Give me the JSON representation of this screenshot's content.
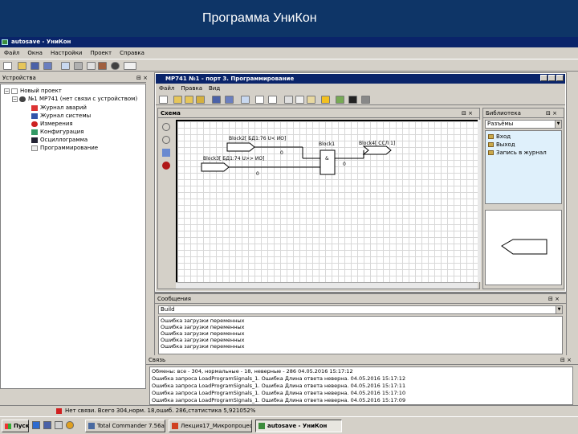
{
  "banner": {
    "title": "Программа УниКон"
  },
  "app": {
    "title": "autosave - УниКон",
    "menu": [
      "Файл",
      "Окна",
      "Настройки",
      "Проект",
      "Справка"
    ]
  },
  "devices_panel": {
    "title": "Устройства",
    "pin": "⊟ ×",
    "root": "Новый проект",
    "device": "№1 МР741 (нет связи с устройством)",
    "items": [
      "Журнал аварий",
      "Журнал системы",
      "Измерения",
      "Конфигурация",
      "Осциллограмма",
      "Программирование"
    ]
  },
  "child_window": {
    "title": "МР741 №1 - порт 3. Программирование",
    "menu": [
      "Файл",
      "Правка",
      "Вид"
    ]
  },
  "scheme": {
    "title": "Схема",
    "pin": "⊟ ×",
    "blocks": {
      "b2": "Block2[ БД1:76  U<     ИО]",
      "b3": "Block3[ БД1:74  U>>    ИО]",
      "b1": "Block1",
      "and": "&",
      "b4": "Block4[ ССЛ 1]",
      "v1": "0",
      "v2": "0",
      "v3": "0"
    }
  },
  "library": {
    "title": "Библиотека",
    "pin": "⊟ ×",
    "selected": "Разъёмы",
    "items": [
      "Вход",
      "Выход",
      "Запись в журнал"
    ]
  },
  "messages": {
    "title": "Сообщения",
    "pin": "⊟ ×",
    "selected": "Build",
    "lines": [
      "Ошибка загрузки переменных",
      "Ошибка загрузки переменных",
      "Ошибка загрузки переменных",
      "Ошибка загрузки переменных",
      "Ошибка загрузки переменных"
    ]
  },
  "link_panel": {
    "title": "Связь",
    "pin": "⊟ ×",
    "lines": [
      "Обмены: все - 304, нормальные - 18, неверные - 286  04.05.2016 15:17:12",
      "Ошибка запроса LoadProgramSignals_1. Ошибка Длина ответа неверна.  04.05.2016 15:17:12",
      "Ошибка запроса LoadProgramSignals_1. Ошибка Длина ответа неверна.  04.05.2016 15:17:11",
      "Ошибка запроса LoadProgramSignals_1. Ошибка Длина ответа неверна.  04.05.2016 15:17:10",
      "Ошибка запроса LoadProgramSignals_1. Ошибка Длина ответа неверна.  04.05.2016 15:17:09"
    ]
  },
  "status_bar": {
    "text": "Нет связи. Всего 304,норм. 18,ошиб. 286,статистика 5,921052%"
  },
  "taskbar": {
    "start": "Пуск",
    "tasks": [
      "Total Commander 7.56a -...",
      "Лекция17_Микропроцес...",
      "autosave - УниКон"
    ]
  },
  "colors": {
    "banner": "#0e3567",
    "titlebar": "#0a246a",
    "window": "#d4d0c8",
    "library_list": "#dff0fb"
  }
}
